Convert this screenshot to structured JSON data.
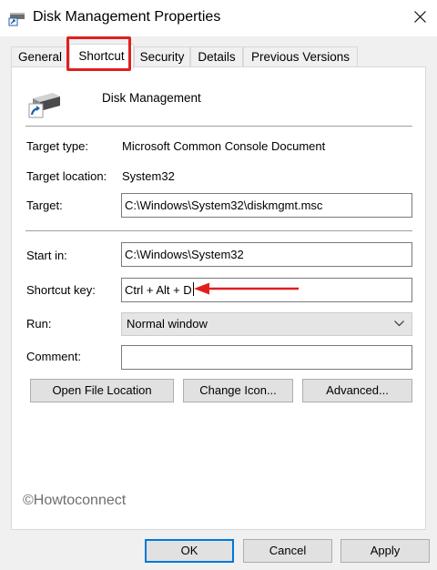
{
  "window": {
    "title": "Disk Management Properties"
  },
  "tabs": [
    {
      "label": "General"
    },
    {
      "label": "Shortcut"
    },
    {
      "label": "Security"
    },
    {
      "label": "Details"
    },
    {
      "label": "Previous Versions"
    }
  ],
  "active_tab": "Shortcut",
  "header": {
    "app_name": "Disk Management"
  },
  "info": {
    "target_type_label": "Target type:",
    "target_type_value": "Microsoft Common Console Document",
    "target_location_label": "Target location:",
    "target_location_value": "System32"
  },
  "fields": {
    "target_label": "Target:",
    "target_value": "C:\\Windows\\System32\\diskmgmt.msc",
    "start_in_label": "Start in:",
    "start_in_value": "C:\\Windows\\System32",
    "shortcut_key_label": "Shortcut key:",
    "shortcut_key_value": "Ctrl + Alt + D",
    "run_label": "Run:",
    "run_value": "Normal window",
    "comment_label": "Comment:",
    "comment_value": ""
  },
  "actions": {
    "open_file_location": "Open File Location",
    "change_icon": "Change Icon...",
    "advanced": "Advanced..."
  },
  "watermark": "©Howtoconnect",
  "footer": {
    "ok": "OK",
    "cancel": "Cancel",
    "apply": "Apply"
  },
  "colors": {
    "highlight": "#e0201c",
    "arrow": "#e0201c",
    "focus_border": "#0078d7"
  },
  "icons": [
    "disk-management-icon",
    "close-icon",
    "shortcut-arrow-icon",
    "chevron-down-icon",
    "annotation-arrow"
  ]
}
